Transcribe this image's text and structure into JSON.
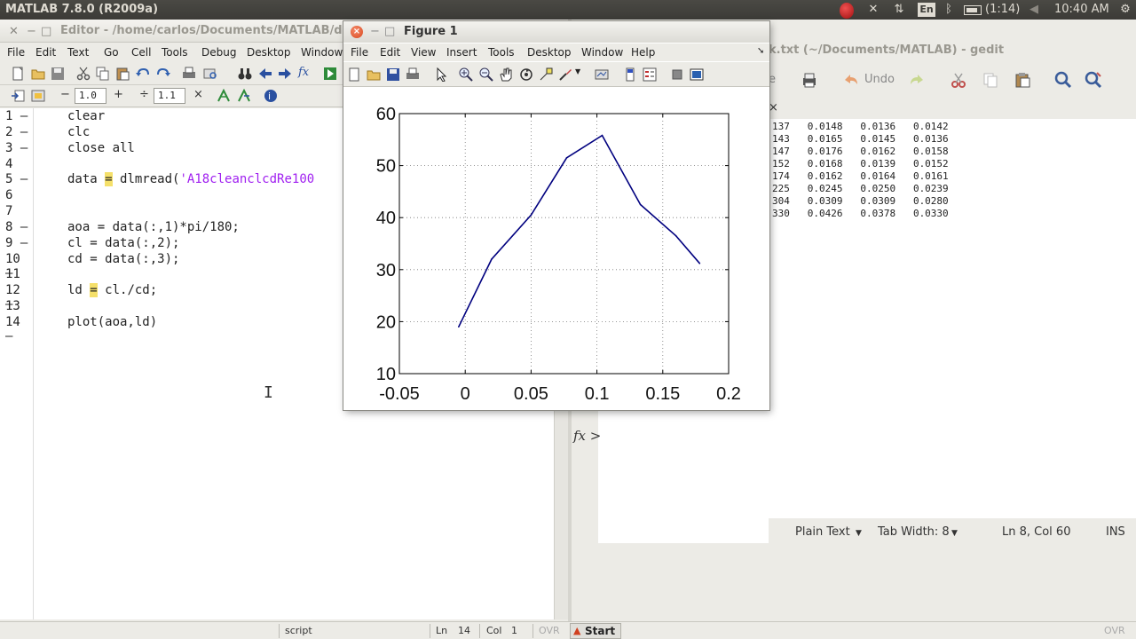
{
  "system_bar": {
    "app_title": "MATLAB  7.8.0 (R2009a)",
    "keyboard_layout": "En",
    "battery": "(1:14)",
    "clock": "10:40 AM"
  },
  "editor": {
    "title": "Editor - /home/carlos/Documents/MATLAB/dlm",
    "menu": [
      "File",
      "Edit",
      "Text",
      "Go",
      "Cell",
      "Tools",
      "Debug",
      "Desktop",
      "Window"
    ],
    "cell_step_value": "1.0",
    "cell_divide_value": "1.1",
    "line_numbers": [
      "1",
      "2",
      "3",
      "4",
      "5",
      "6",
      "7",
      "8",
      "9",
      "10",
      "11",
      "12",
      "13",
      "14"
    ],
    "lines": [
      "clear",
      "clc",
      "close all",
      "",
      "data = dlmread('A18cleanclcdRe100",
      "",
      "",
      "aoa = data(:,1)*pi/180;",
      "cl = data(:,2);",
      "cd = data(:,3);",
      "",
      "ld = cl./cd;",
      "",
      "plot(aoa,ld)"
    ],
    "line5_prefix": "data ",
    "line5_eq": "=",
    "line5_mid": " dlmread(",
    "line5_str": "'A18cleanclcdRe100",
    "line12_prefix": "ld ",
    "line12_eq": "=",
    "line12_rest": " cl./cd;",
    "status": {
      "mode": "script",
      "ln_label": "Ln",
      "ln_value": "14",
      "col_label": "Col",
      "col_value": "1",
      "ovr": "OVR"
    }
  },
  "gedit": {
    "title": "k.txt (~/Documents/MATLAB) - gedit",
    "undo_label": "Undo",
    "tab_close": "×",
    "rows": [
      "137   0.0148   0.0136   0.0142",
      "143   0.0165   0.0145   0.0136",
      "147   0.0176   0.0162   0.0158",
      "152   0.0168   0.0139   0.0152",
      "174   0.0162   0.0164   0.0161",
      "225   0.0245   0.0250   0.0239",
      "304   0.0309   0.0309   0.0280",
      "330   0.0426   0.0378   0.0330"
    ],
    "status": {
      "syntax": "Plain Text",
      "tab_width": "Tab Width: 8",
      "position": "Ln 8, Col 60",
      "mode": "INS"
    }
  },
  "command_window": {
    "prompt": "fx >"
  },
  "taskbar": {
    "start_label": "Start",
    "ovr": "OVR"
  },
  "figure": {
    "title": "Figure 1",
    "menu": [
      "File",
      "Edit",
      "View",
      "Insert",
      "Tools",
      "Desktop",
      "Window",
      "Help"
    ]
  },
  "chart_data": {
    "type": "line",
    "title": "",
    "xlabel": "",
    "ylabel": "",
    "xlim": [
      -0.05,
      0.2
    ],
    "ylim": [
      10,
      60
    ],
    "xticks": [
      "-0.05",
      "0",
      "0.05",
      "0.1",
      "0.15",
      "0.2"
    ],
    "yticks": [
      "10",
      "20",
      "30",
      "40",
      "50",
      "60"
    ],
    "grid": true,
    "line_color": "#00007f",
    "x": [
      -0.005,
      0.02,
      0.05,
      0.077,
      0.104,
      0.133,
      0.16,
      0.178
    ],
    "y": [
      19,
      32,
      40.5,
      51.5,
      55.8,
      42.5,
      36.5,
      31.2
    ]
  }
}
